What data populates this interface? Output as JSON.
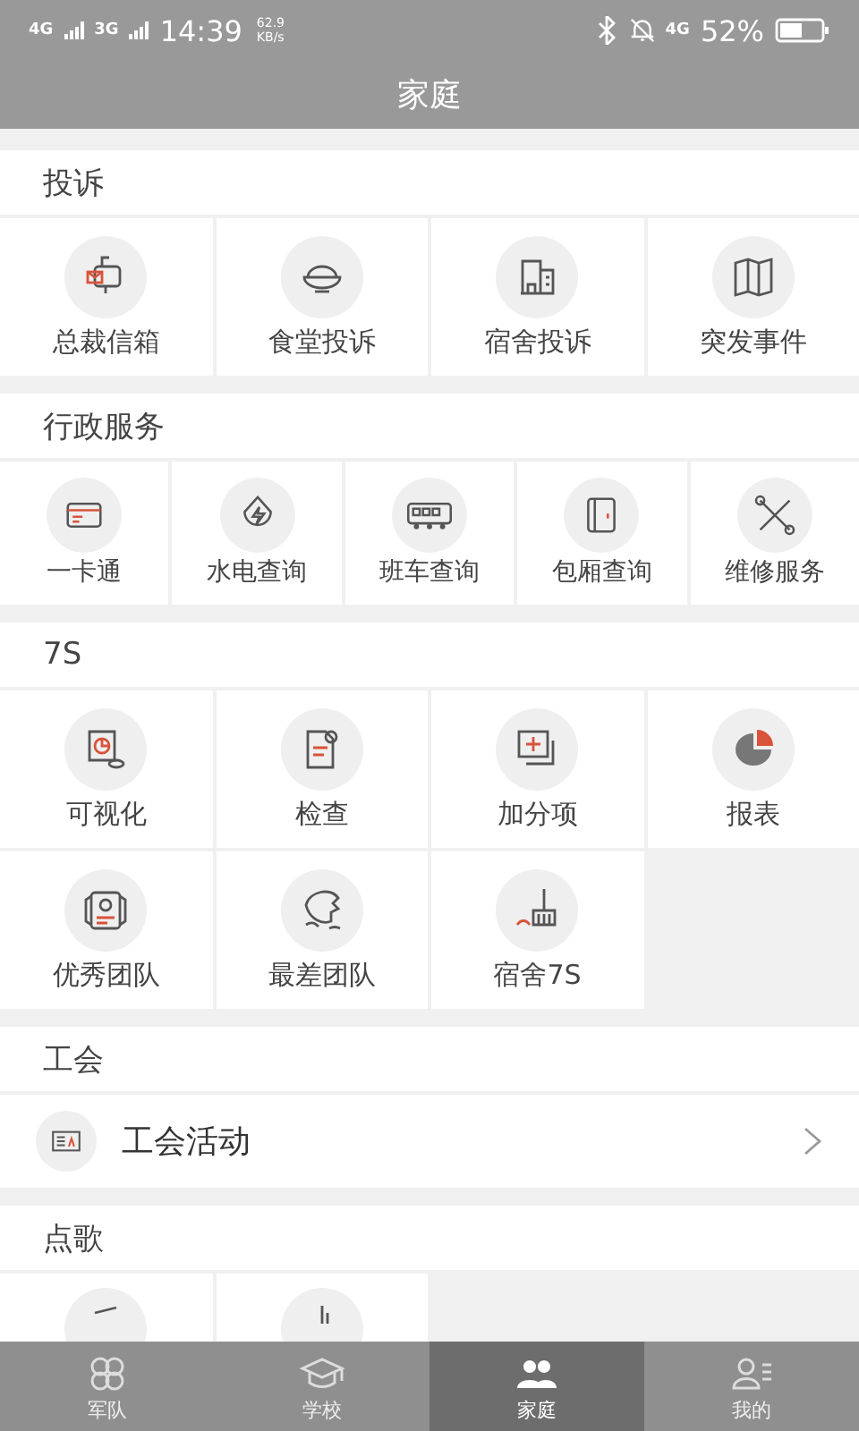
{
  "status_bar": {
    "sim1": "4G",
    "sim2": "3G",
    "time": "14:39",
    "speed": "62.9",
    "speed_unit": "KB/s",
    "network": "4G",
    "battery": "52%"
  },
  "title": "家庭",
  "sections": [
    {
      "title": "投诉",
      "kind": "grid",
      "items": [
        {
          "label": "总裁信箱"
        },
        {
          "label": "食堂投诉"
        },
        {
          "label": "宿舍投诉"
        },
        {
          "label": "突发事件"
        }
      ]
    },
    {
      "title": "行政服务",
      "kind": "strip",
      "items": [
        {
          "label": "一卡通"
        },
        {
          "label": "水电查询"
        },
        {
          "label": "班车查询"
        },
        {
          "label": "包厢查询"
        },
        {
          "label": "维修服务"
        }
      ]
    },
    {
      "title": "7S",
      "kind": "grid",
      "items": [
        {
          "label": "可视化"
        },
        {
          "label": "检查"
        },
        {
          "label": "加分项"
        },
        {
          "label": "报表"
        },
        {
          "label": "优秀团队"
        },
        {
          "label": "最差团队"
        },
        {
          "label": "宿舍7S"
        }
      ]
    },
    {
      "title": "工会",
      "kind": "list",
      "items": [
        {
          "label": "工会活动"
        }
      ]
    },
    {
      "title": "点歌",
      "kind": "grid",
      "items": [
        {
          "covered": true
        },
        {
          "covered": true
        }
      ]
    }
  ],
  "tabs": [
    {
      "label": "军队",
      "selected": false
    },
    {
      "label": "学校",
      "selected": false
    },
    {
      "label": "家庭",
      "selected": true
    },
    {
      "label": "我的",
      "selected": false
    }
  ]
}
